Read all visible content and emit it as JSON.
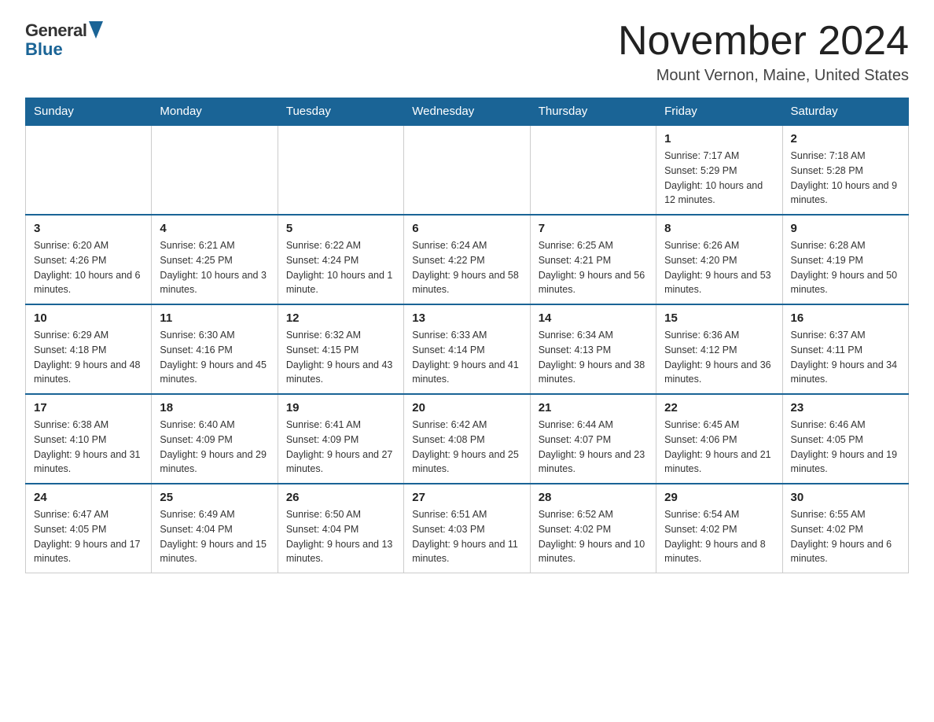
{
  "logo": {
    "general": "General",
    "blue": "Blue"
  },
  "title": "November 2024",
  "subtitle": "Mount Vernon, Maine, United States",
  "days_of_week": [
    "Sunday",
    "Monday",
    "Tuesday",
    "Wednesday",
    "Thursday",
    "Friday",
    "Saturday"
  ],
  "weeks": [
    [
      {
        "day": "",
        "info": ""
      },
      {
        "day": "",
        "info": ""
      },
      {
        "day": "",
        "info": ""
      },
      {
        "day": "",
        "info": ""
      },
      {
        "day": "",
        "info": ""
      },
      {
        "day": "1",
        "info": "Sunrise: 7:17 AM\nSunset: 5:29 PM\nDaylight: 10 hours and 12 minutes."
      },
      {
        "day": "2",
        "info": "Sunrise: 7:18 AM\nSunset: 5:28 PM\nDaylight: 10 hours and 9 minutes."
      }
    ],
    [
      {
        "day": "3",
        "info": "Sunrise: 6:20 AM\nSunset: 4:26 PM\nDaylight: 10 hours and 6 minutes."
      },
      {
        "day": "4",
        "info": "Sunrise: 6:21 AM\nSunset: 4:25 PM\nDaylight: 10 hours and 3 minutes."
      },
      {
        "day": "5",
        "info": "Sunrise: 6:22 AM\nSunset: 4:24 PM\nDaylight: 10 hours and 1 minute."
      },
      {
        "day": "6",
        "info": "Sunrise: 6:24 AM\nSunset: 4:22 PM\nDaylight: 9 hours and 58 minutes."
      },
      {
        "day": "7",
        "info": "Sunrise: 6:25 AM\nSunset: 4:21 PM\nDaylight: 9 hours and 56 minutes."
      },
      {
        "day": "8",
        "info": "Sunrise: 6:26 AM\nSunset: 4:20 PM\nDaylight: 9 hours and 53 minutes."
      },
      {
        "day": "9",
        "info": "Sunrise: 6:28 AM\nSunset: 4:19 PM\nDaylight: 9 hours and 50 minutes."
      }
    ],
    [
      {
        "day": "10",
        "info": "Sunrise: 6:29 AM\nSunset: 4:18 PM\nDaylight: 9 hours and 48 minutes."
      },
      {
        "day": "11",
        "info": "Sunrise: 6:30 AM\nSunset: 4:16 PM\nDaylight: 9 hours and 45 minutes."
      },
      {
        "day": "12",
        "info": "Sunrise: 6:32 AM\nSunset: 4:15 PM\nDaylight: 9 hours and 43 minutes."
      },
      {
        "day": "13",
        "info": "Sunrise: 6:33 AM\nSunset: 4:14 PM\nDaylight: 9 hours and 41 minutes."
      },
      {
        "day": "14",
        "info": "Sunrise: 6:34 AM\nSunset: 4:13 PM\nDaylight: 9 hours and 38 minutes."
      },
      {
        "day": "15",
        "info": "Sunrise: 6:36 AM\nSunset: 4:12 PM\nDaylight: 9 hours and 36 minutes."
      },
      {
        "day": "16",
        "info": "Sunrise: 6:37 AM\nSunset: 4:11 PM\nDaylight: 9 hours and 34 minutes."
      }
    ],
    [
      {
        "day": "17",
        "info": "Sunrise: 6:38 AM\nSunset: 4:10 PM\nDaylight: 9 hours and 31 minutes."
      },
      {
        "day": "18",
        "info": "Sunrise: 6:40 AM\nSunset: 4:09 PM\nDaylight: 9 hours and 29 minutes."
      },
      {
        "day": "19",
        "info": "Sunrise: 6:41 AM\nSunset: 4:09 PM\nDaylight: 9 hours and 27 minutes."
      },
      {
        "day": "20",
        "info": "Sunrise: 6:42 AM\nSunset: 4:08 PM\nDaylight: 9 hours and 25 minutes."
      },
      {
        "day": "21",
        "info": "Sunrise: 6:44 AM\nSunset: 4:07 PM\nDaylight: 9 hours and 23 minutes."
      },
      {
        "day": "22",
        "info": "Sunrise: 6:45 AM\nSunset: 4:06 PM\nDaylight: 9 hours and 21 minutes."
      },
      {
        "day": "23",
        "info": "Sunrise: 6:46 AM\nSunset: 4:05 PM\nDaylight: 9 hours and 19 minutes."
      }
    ],
    [
      {
        "day": "24",
        "info": "Sunrise: 6:47 AM\nSunset: 4:05 PM\nDaylight: 9 hours and 17 minutes."
      },
      {
        "day": "25",
        "info": "Sunrise: 6:49 AM\nSunset: 4:04 PM\nDaylight: 9 hours and 15 minutes."
      },
      {
        "day": "26",
        "info": "Sunrise: 6:50 AM\nSunset: 4:04 PM\nDaylight: 9 hours and 13 minutes."
      },
      {
        "day": "27",
        "info": "Sunrise: 6:51 AM\nSunset: 4:03 PM\nDaylight: 9 hours and 11 minutes."
      },
      {
        "day": "28",
        "info": "Sunrise: 6:52 AM\nSunset: 4:02 PM\nDaylight: 9 hours and 10 minutes."
      },
      {
        "day": "29",
        "info": "Sunrise: 6:54 AM\nSunset: 4:02 PM\nDaylight: 9 hours and 8 minutes."
      },
      {
        "day": "30",
        "info": "Sunrise: 6:55 AM\nSunset: 4:02 PM\nDaylight: 9 hours and 6 minutes."
      }
    ]
  ]
}
